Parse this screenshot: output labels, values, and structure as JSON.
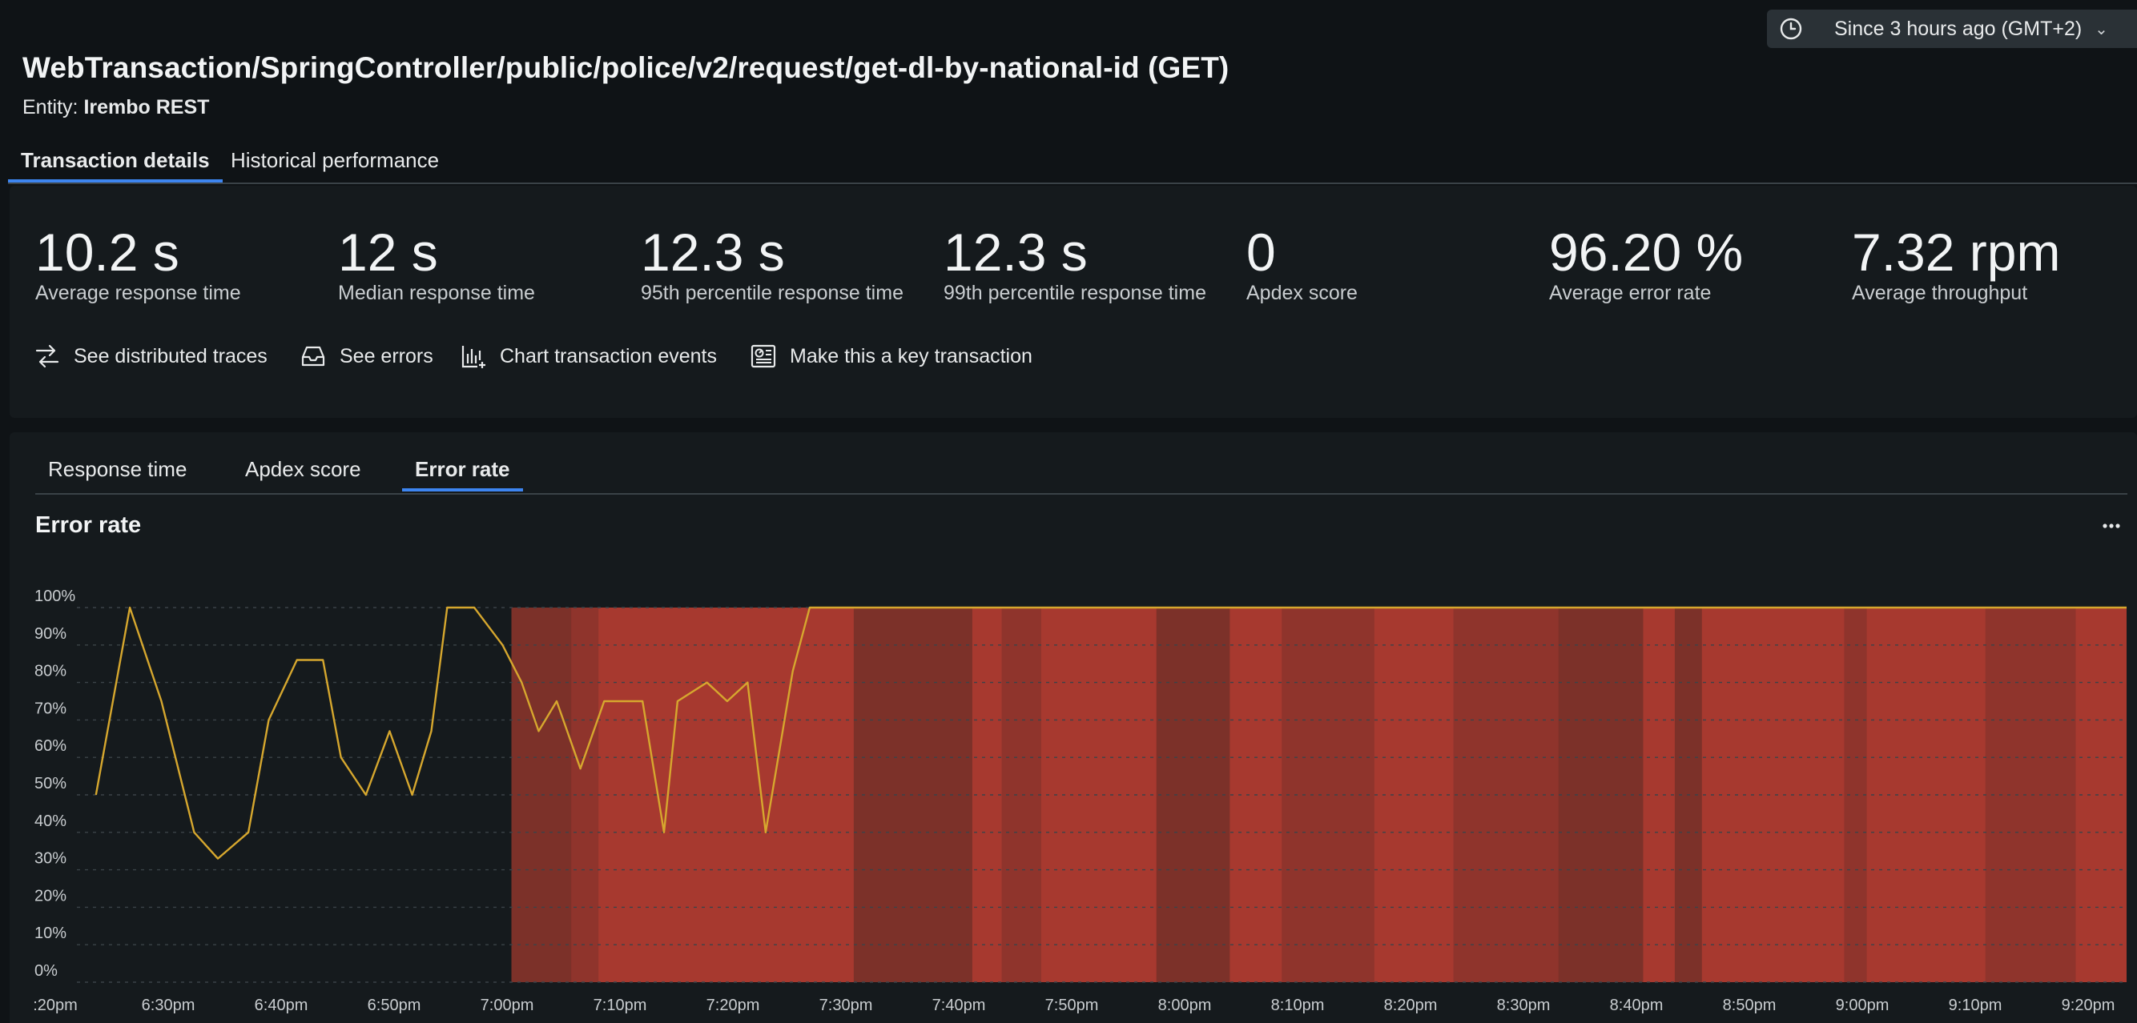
{
  "time_picker": {
    "label": "Since 3 hours ago (GMT+2)",
    "icon": "clock-icon"
  },
  "header": {
    "title": "WebTransaction/SpringController/public/police/v2/request/get-dl-by-national-id (GET)",
    "entity_prefix": "Entity:",
    "entity_name": "Irembo REST"
  },
  "main_tabs": [
    {
      "label": "Transaction details",
      "active": true
    },
    {
      "label": "Historical performance",
      "active": false
    }
  ],
  "metrics": [
    {
      "value": "10.2 s",
      "label": "Average response time"
    },
    {
      "value": "12 s",
      "label": "Median response time"
    },
    {
      "value": "12.3 s",
      "label": "95th percentile response time"
    },
    {
      "value": "12.3 s",
      "label": "99th percentile response time"
    },
    {
      "value": "0",
      "label": "Apdex score"
    },
    {
      "value": "96.20 %",
      "label": "Average error rate"
    },
    {
      "value": "7.32 rpm",
      "label": "Average throughput"
    }
  ],
  "actions": [
    {
      "label": "See distributed traces",
      "icon": "distributed-traces-icon"
    },
    {
      "label": "See errors",
      "icon": "inbox-icon"
    },
    {
      "label": "Chart transaction events",
      "icon": "chart-add-icon"
    },
    {
      "label": "Make this a key transaction",
      "icon": "key-transaction-icon"
    }
  ],
  "chart_tabs": [
    {
      "label": "Response time",
      "active": false
    },
    {
      "label": "Apdex score",
      "active": false
    },
    {
      "label": "Error rate",
      "active": true
    }
  ],
  "chart_title": "Error rate",
  "colors": {
    "line": "#d6a72e",
    "accent_blue": "#3d85f0",
    "alert_band_light": "#a7392f",
    "alert_band_dark": "#7c3129"
  },
  "chart_data": {
    "type": "line",
    "title": "Error rate",
    "yunit": "%",
    "ylim": [
      0,
      100
    ],
    "y_ticks": [
      "0%",
      "10%",
      "20%",
      "30%",
      "40%",
      "50%",
      "60%",
      "70%",
      "80%",
      "90%",
      "100%"
    ],
    "x_ticks": [
      ":20pm",
      "6:30pm",
      "6:40pm",
      "6:50pm",
      "7:00pm",
      "7:10pm",
      "7:20pm",
      "7:30pm",
      "7:40pm",
      "7:50pm",
      "8:00pm",
      "8:10pm",
      "8:20pm",
      "8:30pm",
      "8:40pm",
      "8:50pm",
      "9:00pm",
      "9:10pm",
      "9:20pm"
    ],
    "grid": true,
    "series": [
      {
        "minutes_after_6_20pm": [
          3.6,
          6.6,
          9.4,
          12.3,
          14.4,
          17.1,
          18.9,
          21.4,
          23.7,
          25.3,
          27.5,
          29.6,
          31.6,
          33.3,
          34.7,
          37.1,
          39.6,
          41.3,
          42.8,
          44.4,
          46.5,
          48.6,
          50.3,
          52.0,
          53.9,
          55.1,
          57.7,
          59.5,
          61.3,
          62.9,
          65.3,
          66.8,
          180.0
        ],
        "values": [
          50,
          100,
          75,
          40,
          33,
          40,
          70,
          86,
          86,
          60,
          50,
          67,
          50,
          67,
          100,
          100,
          90,
          80,
          67,
          75,
          57,
          75,
          75,
          75,
          40,
          75,
          80,
          75,
          80,
          40,
          83,
          100,
          100
        ]
      }
    ],
    "alert_bands": [
      {
        "from": "7:01pm",
        "to": "9:20pm",
        "state": "critical"
      }
    ]
  }
}
